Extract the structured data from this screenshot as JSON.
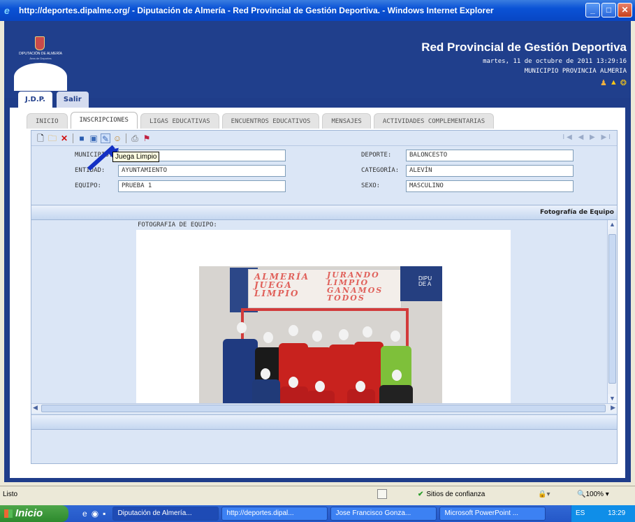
{
  "window": {
    "title": "http://deportes.dipalme.org/ - Diputación de Almería - Red Provincial de Gestión Deportiva. - Windows Internet Explorer",
    "controls": [
      "minimize-icon",
      "maximize-icon",
      "close-icon"
    ]
  },
  "header": {
    "logo_line1": "DIPUTACIÓN DE ALMERÍA",
    "logo_line2": "Área de Deportes",
    "title": "Red Provincial de Gestión Deportiva",
    "date": "martes, 11 de octubre de 2011 13:29:16",
    "municipality": "MUNICIPIO PROVINCIA ALMERIA",
    "icons": [
      "user-icon",
      "warning-icon",
      "help-icon"
    ]
  },
  "main_tabs": [
    {
      "label": "J.D.P.",
      "active": true
    },
    {
      "label": "Salir",
      "active": false
    }
  ],
  "sub_tabs": [
    {
      "label": "INICIO",
      "active": false
    },
    {
      "label": "INSCRIPCIONES",
      "active": true
    },
    {
      "label": "LIGAS EDUCATIVAS",
      "active": false
    },
    {
      "label": "ENCUENTROS EDUCATIVOS",
      "active": false
    },
    {
      "label": "MENSAJES",
      "active": false
    },
    {
      "label": "ACTIVIDADES COMPLEMENTARIAS",
      "active": false
    }
  ],
  "toolbar": {
    "tooltip": "Juega Limpio",
    "pager": "I◀ ◀ ▶ ▶I"
  },
  "form": {
    "municipio_label": "MUNICIPIO:",
    "municipio_value": "",
    "entidad_label": "ENTIDAD:",
    "entidad_value": "AYUNTAMIENTO",
    "equipo_label": "EQUIPO:",
    "equipo_value": "PRUEBA 1",
    "deporte_label": "DEPORTE:",
    "deporte_value": "BALONCESTO",
    "categoria_label": "CATEGORÍA:",
    "categoria_value": "ALEVÍN",
    "sexo_label": "SEXO:",
    "sexo_value": "MASCULINO"
  },
  "photo_section": {
    "title": "Fotografía de Equipo",
    "label": "FOTOGRAFIA DE EQUIPO:",
    "banner_left": "ALMERÍA\nJUEGA\nLIMPIO",
    "banner_right": "JURANDO\nLIMPIO\nGANAMOS\nTODOS",
    "flag_text": "DIPU\nDE A"
  },
  "statusbar": {
    "status": "Listo",
    "trust": "Sitios de confianza",
    "zoom": "100%"
  },
  "taskbar": {
    "start": "Inicio",
    "items": [
      "Diputación de Almería...",
      "http://deportes.dipal...",
      "Jose Francisco Gonza...",
      "Microsoft PowerPoint ..."
    ],
    "tray": "ES",
    "clock": "13:29"
  }
}
